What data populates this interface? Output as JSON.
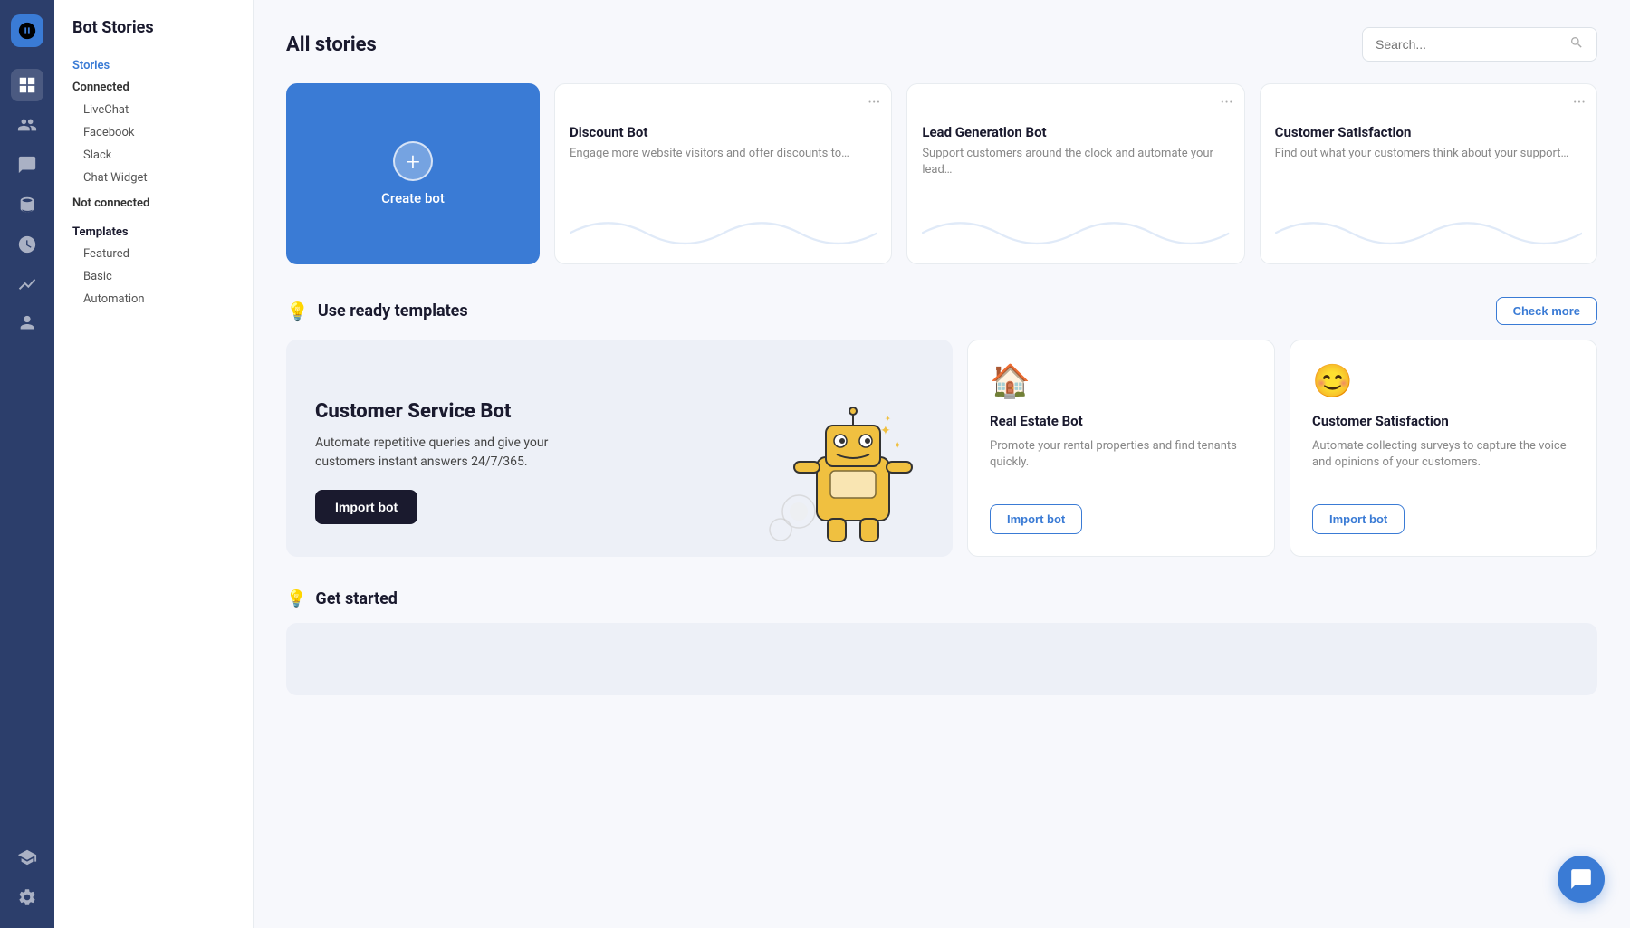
{
  "app": {
    "title": "Bot Stories"
  },
  "sidebar": {
    "title": "Bot Stories",
    "sections": [
      {
        "label": "Stories",
        "items": [
          {
            "group": "Connected",
            "children": [
              "LiveChat",
              "Facebook",
              "Slack",
              "Chat Widget"
            ]
          },
          {
            "group": "Not connected",
            "children": []
          }
        ]
      },
      {
        "label": "Templates",
        "items": [
          "Featured",
          "Basic",
          "Automation"
        ]
      }
    ]
  },
  "header": {
    "page_title": "All stories",
    "search_placeholder": "Search..."
  },
  "all_stories": {
    "create_label": "Create bot",
    "cards": [
      {
        "title": "Discount Bot",
        "description": "Engage more website visitors and offer discounts to…"
      },
      {
        "title": "Lead Generation Bot",
        "description": "Support customers around the clock and automate your lead…"
      },
      {
        "title": "Customer Satisfaction",
        "description": "Find out what your customers think about your support…"
      }
    ]
  },
  "templates_section": {
    "title": "Use ready templates",
    "check_more_label": "Check more",
    "featured": {
      "title": "Customer Service Bot",
      "description": "Automate repetitive queries and give your customers instant answers 24/7/365.",
      "import_label": "Import bot"
    },
    "side_cards": [
      {
        "icon": "🏠",
        "title": "Real Estate Bot",
        "description": "Promote your rental properties and find tenants quickly.",
        "import_label": "Import bot"
      },
      {
        "icon": "😊",
        "title": "Customer Satisfaction",
        "description": "Automate collecting surveys to capture the voice and opinions of your customers.",
        "import_label": "Import bot"
      }
    ]
  },
  "get_started": {
    "title": "Get started"
  },
  "icons": {
    "dashboard": "⊞",
    "users": "👥",
    "chat": "💬",
    "database": "🗄",
    "clock": "🕐",
    "chart": "📈",
    "team": "👤",
    "education": "🎓",
    "settings": "⚙",
    "float_chat": "💬"
  }
}
